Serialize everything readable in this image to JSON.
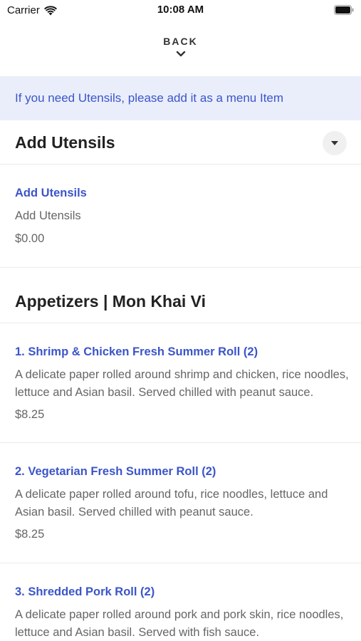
{
  "status_bar": {
    "carrier": "Carrier",
    "time": "10:08 AM"
  },
  "nav": {
    "back_label": "BACK"
  },
  "banner": {
    "text": "If you need Utensils, please add it as a menu Item"
  },
  "sections": [
    {
      "title": "Add Utensils",
      "items": [
        {
          "name": "Add Utensils",
          "description": "Add Utensils",
          "price": "$0.00"
        }
      ]
    },
    {
      "title": "Appetizers | Mon Khai Vi",
      "items": [
        {
          "name": "1. Shrimp & Chicken Fresh Summer Roll (2)",
          "description": "A delicate paper rolled around shrimp and chicken, rice noodles, lettuce and  Asian basil. Served chilled with peanut sauce.",
          "price": "$8.25"
        },
        {
          "name": "2. Vegetarian Fresh Summer Roll (2)",
          "description": "A delicate paper rolled around tofu, rice noodles, lettuce and Asian basil. Served chilled with peanut sauce.",
          "price": "$8.25"
        },
        {
          "name": "3. Shredded Pork Roll (2)",
          "description": "A delicate paper rolled around pork and pork skin, rice noodles, lettuce and Asian basil. Served with fish sauce."
        }
      ]
    }
  ],
  "colors": {
    "accent": "#3b55c9",
    "banner_bg": "#eaeefb",
    "muted_text": "#666666"
  }
}
